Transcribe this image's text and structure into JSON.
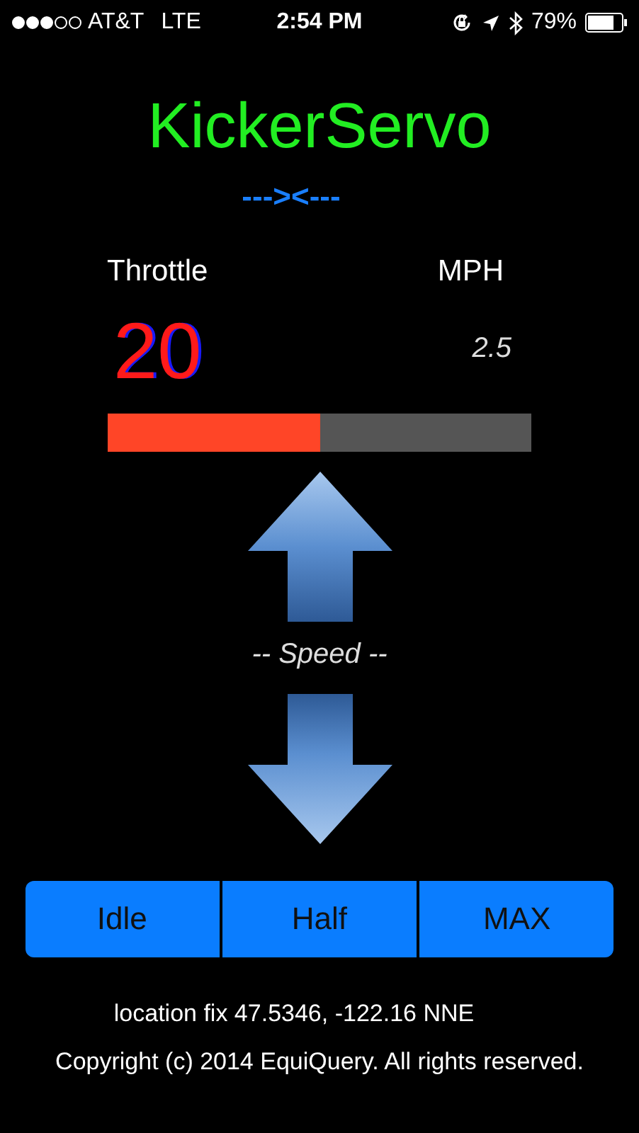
{
  "status_bar": {
    "carrier": "AT&T",
    "network": "LTE",
    "time": "2:54 PM",
    "battery": "79%"
  },
  "title": "KickerServo",
  "indicator": "---><---",
  "gauges": [
    {
      "label": "Throttle",
      "value": "20"
    },
    {
      "label": "MPH",
      "value": "2.5"
    }
  ],
  "throttle_bar": {
    "level": 0.5
  },
  "speed_label": "-- Speed --",
  "buttons": [
    "Idle",
    "Half",
    "MAX"
  ],
  "location": "location fix 47.5346, -122.16  NNE",
  "copyright": "Copyright (c) 2014 EquiQuery. All rights reserved."
}
